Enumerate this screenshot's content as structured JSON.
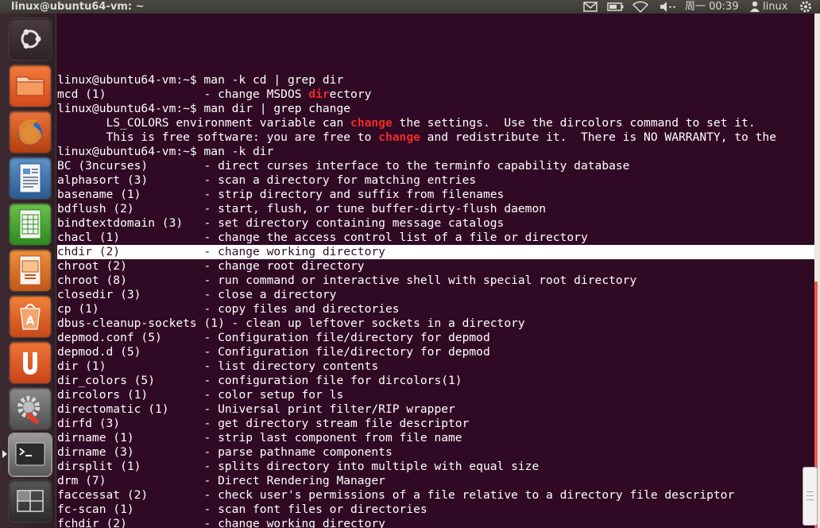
{
  "top_panel": {
    "window_title": "linux@ubuntu64-vm: ~",
    "clock": "周一 00:39",
    "user": "linux"
  },
  "launcher": {
    "items": [
      {
        "name": "dash-home",
        "icon": "ubuntu-logo-icon"
      },
      {
        "name": "files",
        "icon": "folder-icon"
      },
      {
        "name": "firefox",
        "icon": "firefox-icon"
      },
      {
        "name": "writer",
        "icon": "document-icon"
      },
      {
        "name": "calc",
        "icon": "spreadsheet-icon"
      },
      {
        "name": "impress",
        "icon": "presentation-icon"
      },
      {
        "name": "software-center",
        "icon": "software-center-icon"
      },
      {
        "name": "ubuntu-one",
        "icon": "ubuntu-one-icon"
      },
      {
        "name": "system-settings",
        "icon": "gear-icon"
      },
      {
        "name": "terminal",
        "icon": "terminal-icon"
      },
      {
        "name": "workspace-switcher",
        "icon": "workspaces-icon"
      }
    ]
  },
  "terminal": {
    "lines": [
      {
        "text": "linux@ubuntu64-vm:~$ man -k cd | grep dir"
      },
      {
        "parts": [
          "mcd (1)              - change MSDOS ",
          "dir",
          "ectory"
        ]
      },
      {
        "text": "linux@ubuntu64-vm:~$ man dir | grep change"
      },
      {
        "parts": [
          "       LS_COLORS environment variable can ",
          "change",
          " the settings.  Use the dircolors command to set it."
        ]
      },
      {
        "parts": [
          "       This is free software: you are free to ",
          "change",
          " and redistribute it.  There is NO WARRANTY, to the"
        ]
      },
      {
        "text": "linux@ubuntu64-vm:~$ man -k dir"
      },
      {
        "text": "BC (3ncurses)        - direct curses interface to the terminfo capability database"
      },
      {
        "text": "alphasort (3)        - scan a directory for matching entries"
      },
      {
        "text": "basename (1)         - strip directory and suffix from filenames"
      },
      {
        "text": "bdflush (2)          - start, flush, or tune buffer-dirty-flush daemon"
      },
      {
        "text": "bindtextdomain (3)   - set directory containing message catalogs"
      },
      {
        "text": "chacl (1)            - change the access control list of a file or directory"
      },
      {
        "text": "chdir (2)            - change working directory",
        "selected": true
      },
      {
        "text": "chroot (2)           - change root directory"
      },
      {
        "text": "chroot (8)           - run command or interactive shell with special root directory"
      },
      {
        "text": "closedir (3)         - close a directory"
      },
      {
        "text": "cp (1)               - copy files and directories"
      },
      {
        "text": "dbus-cleanup-sockets (1) - clean up leftover sockets in a directory"
      },
      {
        "text": "depmod.conf (5)      - Configuration file/directory for depmod"
      },
      {
        "text": "depmod.d (5)         - Configuration file/directory for depmod"
      },
      {
        "text": "dir (1)              - list directory contents"
      },
      {
        "text": "dir_colors (5)       - configuration file for dircolors(1)"
      },
      {
        "text": "dircolors (1)        - color setup for ls"
      },
      {
        "text": "directomatic (1)     - Universal print filter/RIP wrapper"
      },
      {
        "text": "dirfd (3)            - get directory stream file descriptor"
      },
      {
        "text": "dirname (1)          - strip last component from file name"
      },
      {
        "text": "dirname (3)          - parse pathname components"
      },
      {
        "text": "dirsplit (1)         - splits directory into multiple with equal size"
      },
      {
        "text": "drm (7)              - Direct Rendering Manager"
      },
      {
        "text": "faccessat (2)        - check user's permissions of a file relative to a directory file descriptor"
      },
      {
        "text": "fc-scan (1)          - scan font files or directories"
      },
      {
        "text": "fchdir (2)           - change working directory"
      }
    ]
  },
  "colors": {
    "terminal_bg": "#300a24",
    "match_highlight": "#ef2929",
    "panel_bg": "#3c3b37"
  }
}
